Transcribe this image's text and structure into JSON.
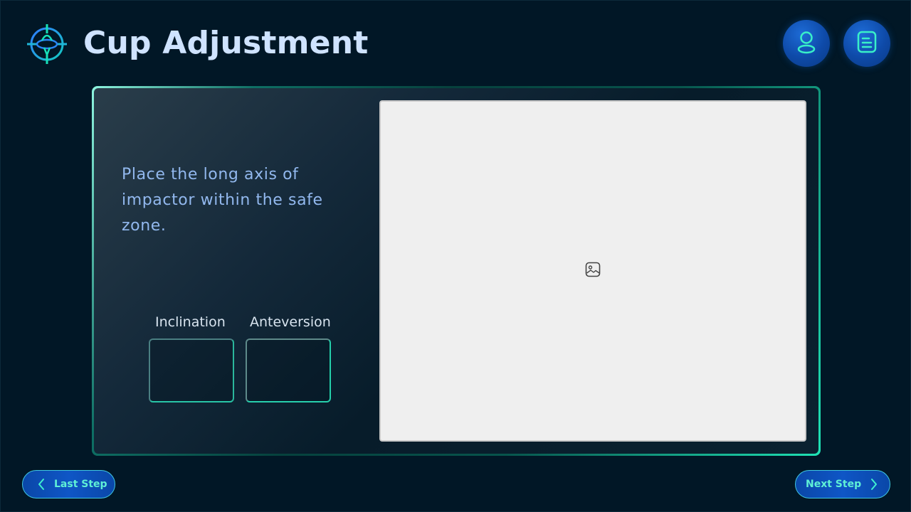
{
  "header": {
    "title": "Cup Adjustment",
    "logo_icon": "crosshair-target-icon",
    "user_icon": "user-icon",
    "notes_icon": "notes-icon"
  },
  "panel": {
    "instruction": "Place the long axis of impactor within the safe zone.",
    "fields": {
      "inclination_label": "Inclination",
      "inclination_value": "",
      "anteversion_label": "Anteversion",
      "anteversion_value": ""
    },
    "image_placeholder_icon": "image-icon"
  },
  "footer": {
    "prev_label": "Last Step",
    "next_label": "Next Step"
  },
  "colors": {
    "background": "#011726",
    "title": "#cfe3ff",
    "accent_teal": "#1fe3b5",
    "button_blue": "#0e4aa8",
    "instruction_text": "#92b8ee"
  }
}
